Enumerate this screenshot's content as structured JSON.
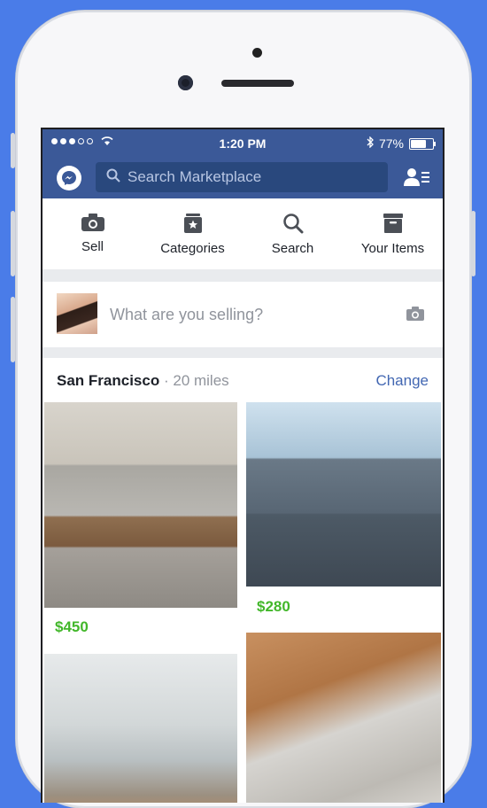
{
  "status_bar": {
    "time": "1:20 PM",
    "battery": "77%",
    "battery_level": 0.77
  },
  "header": {
    "search_placeholder": "Search Marketplace"
  },
  "tabs": [
    {
      "label": "Sell",
      "icon": "camera-icon"
    },
    {
      "label": "Categories",
      "icon": "categories-icon"
    },
    {
      "label": "Search",
      "icon": "search-icon"
    },
    {
      "label": "Your Items",
      "icon": "inbox-icon"
    }
  ],
  "composer": {
    "placeholder": "What are you selling?"
  },
  "location": {
    "city": "San Francisco",
    "separator": "·",
    "distance": "20 miles",
    "change": "Change"
  },
  "listings": [
    {
      "price": "$450",
      "image": "sofa-photo"
    },
    {
      "price": "$280",
      "image": "bicycle-photo"
    },
    {
      "price": "",
      "image": "kettle-photo"
    },
    {
      "price": "",
      "image": "teddy-bears-photo"
    }
  ],
  "colors": {
    "brand": "#3b5998",
    "price": "#42b72a",
    "link": "#4267b2"
  }
}
